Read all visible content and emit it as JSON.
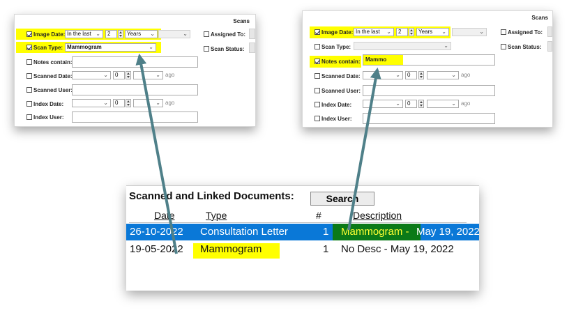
{
  "left_panel": {
    "title": "Scans",
    "image_date": {
      "label": "Image Date:",
      "mode": "In the last",
      "count": "2",
      "unit": "Years"
    },
    "scan_type": {
      "label": "Scan Type:",
      "value": "Mammogram"
    },
    "notes_contain": {
      "label": "Notes contain:",
      "value": ""
    },
    "scanned_date": {
      "label": "Scanned Date:",
      "count": "0",
      "suffix": "ago"
    },
    "scanned_user": {
      "label": "Scanned User:"
    },
    "index_date": {
      "label": "Index Date:",
      "count": "0",
      "suffix": "ago"
    },
    "index_user": {
      "label": "Index User:"
    },
    "assigned_to": {
      "label": "Assigned To:"
    },
    "scan_status": {
      "label": "Scan Status:"
    }
  },
  "right_panel": {
    "title": "Scans",
    "image_date": {
      "label": "Image Date:",
      "mode": "In the last",
      "count": "2",
      "unit": "Years"
    },
    "scan_type": {
      "label": "Scan Type:",
      "value": ""
    },
    "notes_contain": {
      "label": "Notes contain:",
      "value": "Mammo"
    },
    "scanned_date": {
      "label": "Scanned Date:",
      "count": "0",
      "suffix": "ago"
    },
    "scanned_user": {
      "label": "Scanned User:"
    },
    "index_date": {
      "label": "Index Date:",
      "count": "0",
      "suffix": "ago"
    },
    "index_user": {
      "label": "Index User:"
    },
    "assigned_to": {
      "label": "Assigned To:"
    },
    "scan_status": {
      "label": "Scan Status:"
    }
  },
  "documents": {
    "title": "Scanned and Linked Documents:",
    "search_label": "Search",
    "columns": {
      "date": "Date",
      "type": "Type",
      "num": "#",
      "description": "Description"
    },
    "rows": [
      {
        "date": "26-10-2022",
        "type": "Consultation Letter",
        "num": "1",
        "desc_highlight": "Mammogram -",
        "desc_rest": " May 19, 2022"
      },
      {
        "date": "19-05-2022",
        "type": "Mammogram",
        "num": "1",
        "desc": "No Desc - May 19, 2022"
      }
    ]
  },
  "colors": {
    "highlight": "#ffff00",
    "selection": "#0a78d7",
    "green_highlight": "#0b7a18",
    "arrow": "#4f8089"
  }
}
